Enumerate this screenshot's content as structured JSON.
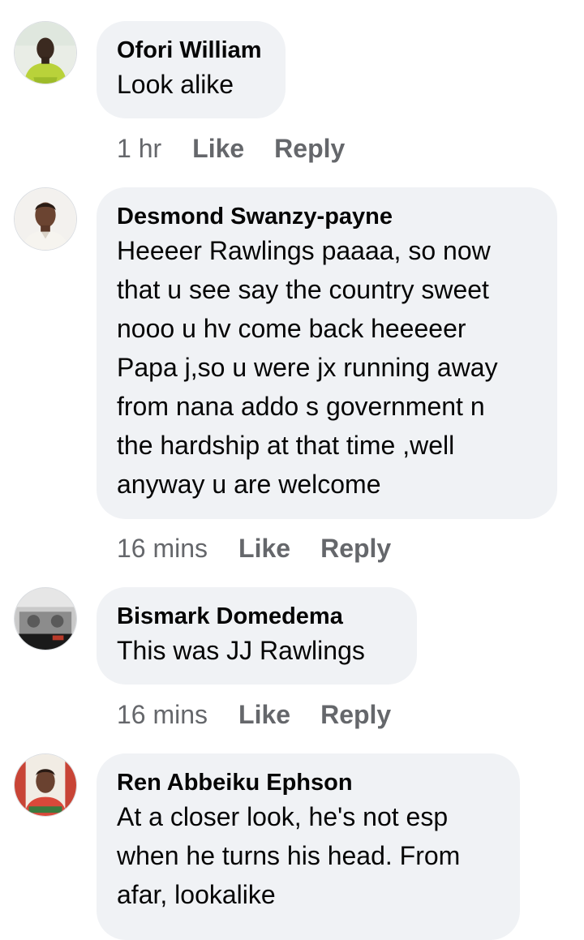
{
  "comments": [
    {
      "author": "Ofori William",
      "text": "Look alike",
      "time": "1 hr",
      "like_label": "Like",
      "reply_label": "Reply"
    },
    {
      "author": "Desmond Swanzy-payne",
      "text": "Heeeer Rawlings paaaa, so now\nthat u see say the country sweet\nnooo u hv come back heeeeer\nPapa j,so u were jx running away\nfrom nana addo s government n\nthe hardship at that time ,well\nanyway u are welcome",
      "time": "16 mins",
      "like_label": "Like",
      "reply_label": "Reply"
    },
    {
      "author": "Bismark Domedema",
      "text": "This was JJ Rawlings",
      "time": "16 mins",
      "like_label": "Like",
      "reply_label": "Reply"
    },
    {
      "author": "Ren Abbeiku Ephson",
      "text": "At a closer look, he's not esp\nwhen he turns his head. From\nafar, lookalike"
    }
  ],
  "colors": {
    "bubble": "#f0f2f5",
    "meta_text": "#65676b",
    "text": "#050505"
  }
}
